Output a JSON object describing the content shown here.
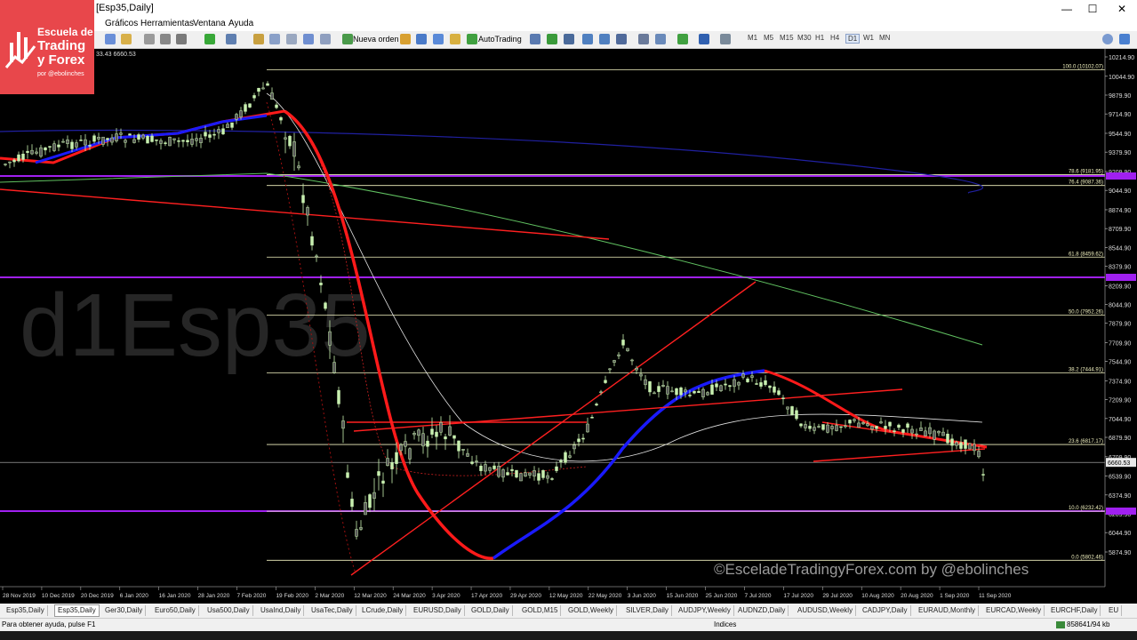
{
  "window": {
    "title": "[Esp35,Daily]",
    "minimize": "—",
    "maximize": "☐",
    "close": "✕"
  },
  "logo": {
    "line1": "Escuela de",
    "line2": "Trading",
    "line3": "y Forex",
    "line4": "por @ebolinches"
  },
  "menu": [
    "Gráficos",
    "Herramientas",
    "Ventana",
    "Ayuda"
  ],
  "toolbar": {
    "new_order": "Nueva orden",
    "autotrading": "AutoTrading",
    "timeframes": [
      "M1",
      "M5",
      "M15",
      "M30",
      "H1",
      "H4",
      "D1",
      "W1",
      "MN"
    ],
    "active_timeframe": "D1"
  },
  "chart": {
    "ohlc_header": "33.43 6660.53",
    "watermark": "d1Esp35",
    "copyright": "©EsceladeTradingyForex.com by @ebolinches",
    "price_scale": [
      "10214.90",
      "10044.90",
      "9879.90",
      "9714.90",
      "9544.90",
      "9379.90",
      "9209.90",
      "9044.90",
      "8874.90",
      "8709.90",
      "8544.90",
      "8379.90",
      "8209.90",
      "8044.90",
      "7879.90",
      "7709.90",
      "7544.90",
      "7374.90",
      "7209.90",
      "7044.90",
      "6879.90",
      "6709.90",
      "6539.90",
      "6374.90",
      "6209.90",
      "6044.90",
      "5874.90"
    ],
    "current_price": "6660.53",
    "fib_levels": [
      {
        "label": "100.0 (10102.07)",
        "price": 10102.07
      },
      {
        "label": "78.6 (9181.95)",
        "price": 9181.95
      },
      {
        "label": "76.4 (9087.36)",
        "price": 9087.36
      },
      {
        "label": "61.8 (8459.62)",
        "price": 8459.62
      },
      {
        "label": "50.0 (7952.26)",
        "price": 7952.26
      },
      {
        "label": "38.2 (7444.91)",
        "price": 7444.91
      },
      {
        "label": "23.6 (6817.17)",
        "price": 6817.17
      },
      {
        "label": "10.0 (6232.42)",
        "price": 6232.42
      },
      {
        "label": "0.0 (5802.46)",
        "price": 5802.46
      }
    ],
    "date_scale": [
      "28 Nov 2019",
      "10 Dec 2019",
      "20 Dec 2019",
      "6 Jan 2020",
      "16 Jan 2020",
      "28 Jan 2020",
      "7 Feb 2020",
      "19 Feb 2020",
      "2 Mar 2020",
      "12 Mar 2020",
      "24 Mar 2020",
      "3 Apr 2020",
      "17 Apr 2020",
      "29 Apr 2020",
      "12 May 2020",
      "22 May 2020",
      "3 Jun 2020",
      "15 Jun 2020",
      "25 Jun 2020",
      "7 Jul 2020",
      "17 Jul 2020",
      "29 Jul 2020",
      "10 Aug 2020",
      "20 Aug 2020",
      "1 Sep 2020",
      "11 Sep 2020"
    ],
    "colors": {
      "background": "#000000",
      "fib": "#f2f2c0",
      "trend": "#ff2020",
      "support_resistance": "#a020f0",
      "bull_candle": "#c8f0b0",
      "ma_red": "#ff1a1a",
      "ma_blue": "#1a1aff"
    }
  },
  "tabs": [
    "Esp35,Daily",
    "Esp35,Daily",
    "Ger30,Daily",
    "Euro50,Daily",
    "Usa500,Daily",
    "UsaInd,Daily",
    "UsaTec,Daily",
    "LCrude,Daily",
    "EURUSD,Daily",
    "GOLD,Daily",
    "GOLD,M15",
    "GOLD,Weekly",
    "SILVER,Daily",
    "AUDJPY,Weekly",
    "AUDNZD,Daily",
    "AUDUSD,Weekly",
    "CADJPY,Daily",
    "EURAUD,Monthly",
    "EURCAD,Weekly",
    "EURCHF,Daily",
    "EU"
  ],
  "active_tab_index": 1,
  "status": {
    "help": "Para obtener ayuda, pulse F1",
    "profile": "Indices",
    "traffic": "858641/94 kb"
  }
}
